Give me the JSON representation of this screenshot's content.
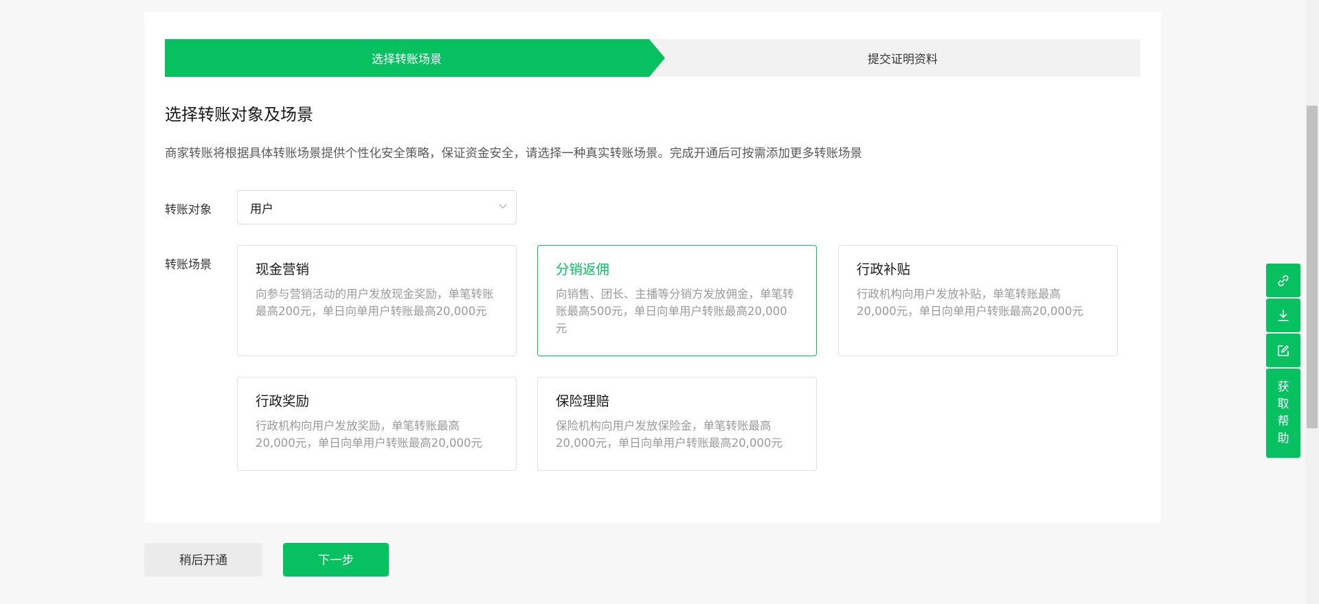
{
  "steps": {
    "active": "选择转账场景",
    "next": "提交证明资料"
  },
  "section": {
    "title": "选择转账对象及场景",
    "description": "商家转账将根据具体转账场景提供个性化安全策略，保证资金安全，请选择一种真实转账场景。完成开通后可按需添加更多转账场景"
  },
  "transfer_target": {
    "label": "转账对象",
    "selected_value": "用户"
  },
  "transfer_scene": {
    "label": "转账场景",
    "scenes": [
      {
        "title": "现金营销",
        "description": "向参与营销活动的用户发放现金奖励，单笔转账最高200元，单日向单用户转账最高20,000元",
        "selected": false
      },
      {
        "title": "分销返佣",
        "description": "向销售、团长、主播等分销方发放佣金，单笔转账最高500元，单日向单用户转账最高20,000元",
        "selected": true
      },
      {
        "title": "行政补贴",
        "description": "行政机构向用户发放补贴，单笔转账最高20,000元，单日向单用户转账最高20,000元",
        "selected": false
      },
      {
        "title": "行政奖励",
        "description": "行政机构向用户发放奖励，单笔转账最高20,000元，单日向单用户转账最高20,000元",
        "selected": false
      },
      {
        "title": "保险理赔",
        "description": "保险机构向用户发放保险金，单笔转账最高20,000元，单日向单用户转账最高20,000元",
        "selected": false
      }
    ]
  },
  "actions": {
    "later_label": "稍后开通",
    "next_label": "下一步"
  },
  "floating_tools": {
    "icons": [
      "link-icon",
      "download-icon",
      "edit-icon"
    ],
    "help_label": "获取帮助"
  },
  "colors": {
    "accent": "#07c160",
    "background": "#f7f7f7"
  }
}
